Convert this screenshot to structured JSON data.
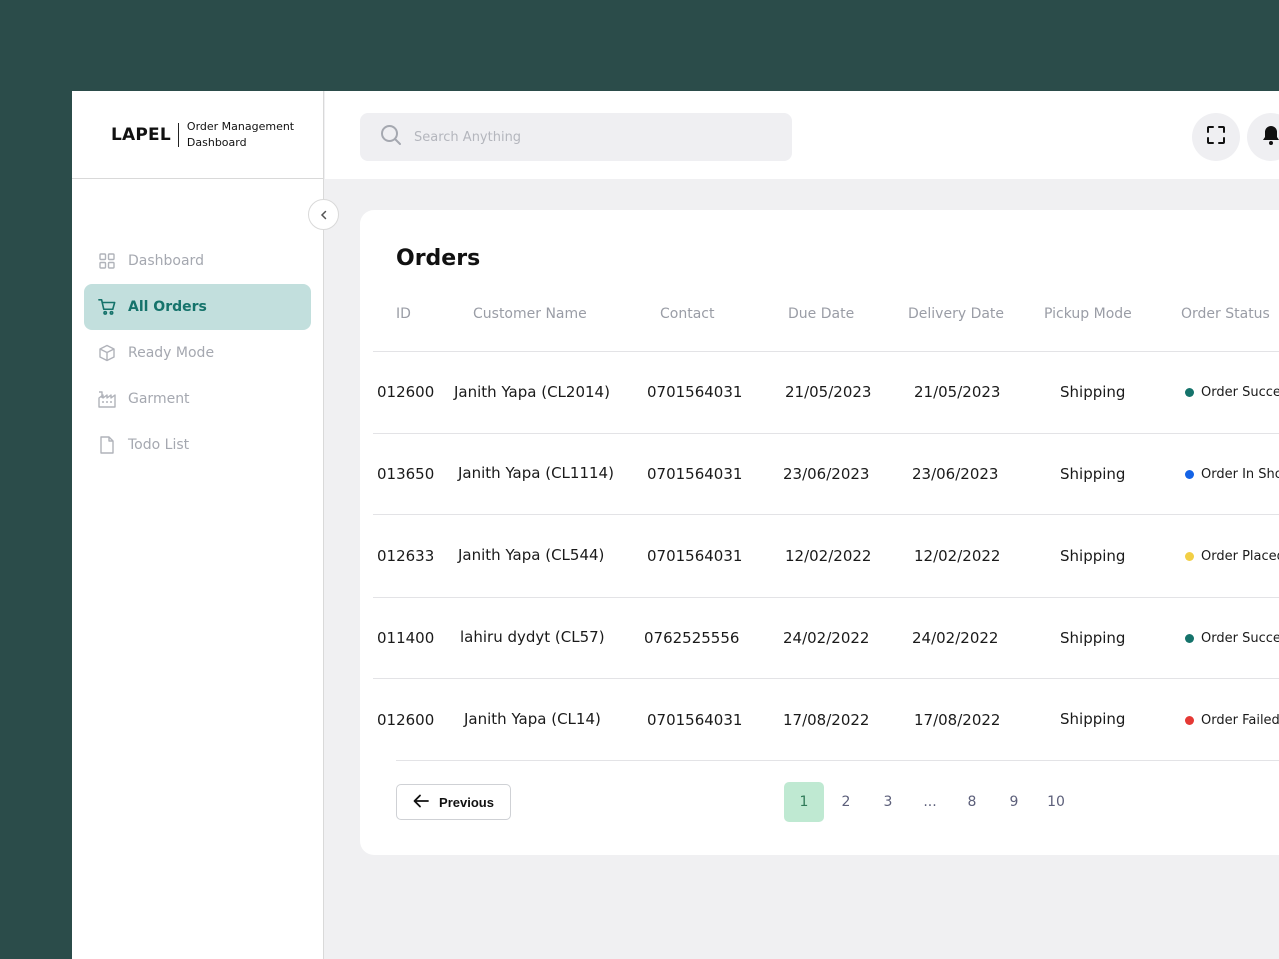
{
  "brand": {
    "logo": "LAPEL",
    "subtitle": "Order Management Dashboard"
  },
  "sidebar": {
    "items": [
      {
        "label": "Dashboard",
        "icon": "grid-icon",
        "active": false
      },
      {
        "label": "All Orders",
        "icon": "cart-icon",
        "active": true
      },
      {
        "label": "Ready Mode",
        "icon": "box-icon",
        "active": false
      },
      {
        "label": "Garment",
        "icon": "factory-icon",
        "active": false
      },
      {
        "label": "Todo List",
        "icon": "file-icon",
        "active": false
      }
    ]
  },
  "search": {
    "placeholder": "Search Anything",
    "value": ""
  },
  "orders": {
    "title": "Orders",
    "columns": [
      "ID",
      "Customer Name",
      "Contact",
      "Due Date",
      "Delivery Date",
      "Pickup Mode",
      "Order Status"
    ],
    "rows": [
      {
        "id": "012600",
        "customer": "Janith Yapa (CL2014)",
        "contact": "0701564031",
        "due": "21/05/2023",
        "delivery": "21/05/2023",
        "pickup": "Shipping",
        "status": "Order Success",
        "status_color": "#15736b"
      },
      {
        "id": "013650",
        "customer": "Janith Yapa (CL1114)",
        "contact": "0701564031",
        "due": "23/06/2023",
        "delivery": "23/06/2023",
        "pickup": "Shipping",
        "status": "Order In Shop",
        "status_color": "#1463e6"
      },
      {
        "id": "012633",
        "customer": "Janith Yapa (CL544)",
        "contact": "0701564031",
        "due": "12/02/2022",
        "delivery": "12/02/2022",
        "pickup": "Shipping",
        "status": "Order Placed",
        "status_color": "#f2cf45"
      },
      {
        "id": "011400",
        "customer": "lahiru dydyt (CL57)",
        "contact": "0762525556",
        "due": "24/02/2022",
        "delivery": "24/02/2022",
        "pickup": "Shipping",
        "status": "Order Success",
        "status_color": "#15736b"
      },
      {
        "id": "012600",
        "customer": "Janith Yapa (CL14)",
        "contact": "0701564031",
        "due": "17/08/2022",
        "delivery": "17/08/2022",
        "pickup": "Shipping",
        "status": "Order Failed",
        "status_color": "#e53935"
      }
    ]
  },
  "pagination": {
    "previous_label": "Previous",
    "pages": [
      "1",
      "2",
      "3",
      "...",
      "8",
      "9",
      "10"
    ],
    "current": "1"
  },
  "colors": {
    "background": "#2b4c4a",
    "accent": "#15736b",
    "active_nav": "#c2dfdd",
    "active_page": "#bfe9d2"
  }
}
